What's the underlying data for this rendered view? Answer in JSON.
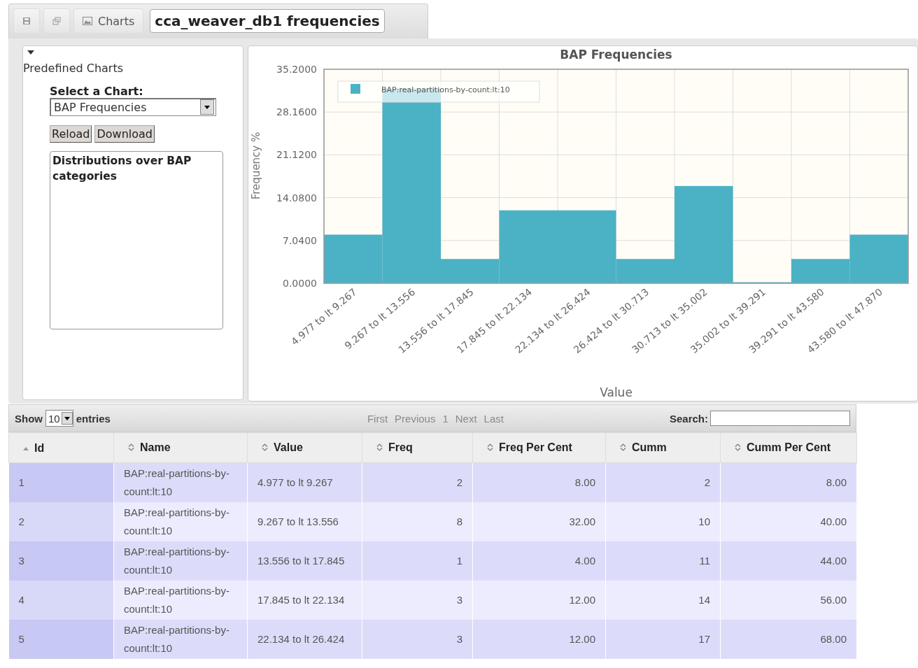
{
  "toolbar": {
    "tab_label": "Charts",
    "title": "cca_weaver_db1 frequencies"
  },
  "sidebar": {
    "heading": "Predefined Charts",
    "select_label": "Select a Chart:",
    "select_value": "BAP Frequencies",
    "buttons": [
      "Reload",
      "Download"
    ],
    "description": "Distributions over BAP categories"
  },
  "chart": {
    "chart_data": {
      "type": "bar",
      "title": "BAP Frequencies",
      "xlabel": "Value",
      "ylabel": "Frequency %",
      "categories": [
        "4.977 to lt 9.267",
        "9.267 to lt 13.556",
        "13.556 to lt 17.845",
        "17.845 to lt 22.134",
        "22.134 to lt 26.424",
        "26.424 to lt 30.713",
        "30.713 to lt 35.002",
        "35.002 to lt 39.291",
        "39.291 to lt 43.580",
        "43.580 to lt 47.870"
      ],
      "series": [
        {
          "name": "BAP:real-partitions-by-count:lt:10",
          "color": "#4bb2c5",
          "values": [
            8,
            32,
            4,
            12,
            12,
            4,
            16,
            0,
            4,
            8
          ]
        }
      ],
      "ylim": [
        0,
        35.2
      ],
      "grid": true,
      "yticks": [
        {
          "value": 0,
          "label": "0.0000"
        },
        {
          "value": 7.04,
          "label": "7.0400"
        },
        {
          "value": 14.08,
          "label": "14.0800"
        },
        {
          "value": 21.12,
          "label": "21.1200"
        },
        {
          "value": 28.16,
          "label": "28.1600"
        },
        {
          "value": 35.2,
          "label": "35.2000"
        }
      ]
    }
  },
  "table": {
    "show_label": "Show",
    "page_size": "10",
    "entries_label": "entries",
    "pager": [
      {
        "label": "First",
        "disabled": true
      },
      {
        "label": "Previous",
        "disabled": true
      },
      {
        "label": "1",
        "disabled": true
      },
      {
        "label": "Next",
        "disabled": true
      },
      {
        "label": "Last",
        "disabled": true
      }
    ],
    "search_label": "Search:",
    "columns": [
      {
        "label": "Id",
        "sorted": true
      },
      {
        "label": "Name",
        "sorted": false
      },
      {
        "label": "Value",
        "sorted": false
      },
      {
        "label": "Freq",
        "sorted": false
      },
      {
        "label": "Freq Per Cent",
        "sorted": false
      },
      {
        "label": "Cumm",
        "sorted": false
      },
      {
        "label": "Cumm Per Cent",
        "sorted": false
      }
    ],
    "rows": [
      [
        "1",
        "BAP:real-partitions-by-count:lt:10",
        "4.977 to lt 9.267",
        "2",
        "8.00",
        "2",
        "8.00"
      ],
      [
        "2",
        "BAP:real-partitions-by-count:lt:10",
        "9.267 to lt 13.556",
        "8",
        "32.00",
        "10",
        "40.00"
      ],
      [
        "3",
        "BAP:real-partitions-by-count:lt:10",
        "13.556 to lt 17.845",
        "1",
        "4.00",
        "11",
        "44.00"
      ],
      [
        "4",
        "BAP:real-partitions-by-count:lt:10",
        "17.845 to lt 22.134",
        "3",
        "12.00",
        "14",
        "56.00"
      ],
      [
        "5",
        "BAP:real-partitions-by-count:lt:10",
        "22.134 to lt 26.424",
        "3",
        "12.00",
        "17",
        "68.00"
      ]
    ]
  }
}
